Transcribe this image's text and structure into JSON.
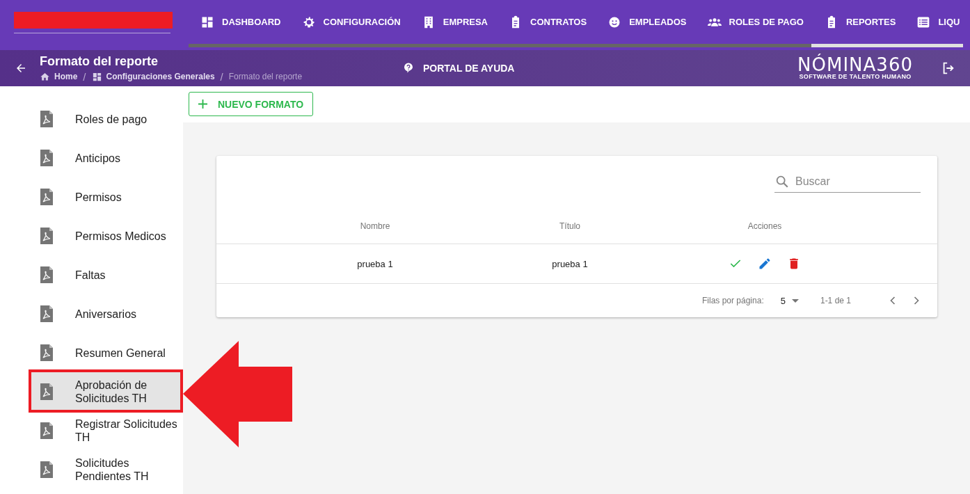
{
  "nav": {
    "items": [
      {
        "label": "DASHBOARD"
      },
      {
        "label": "CONFIGURACIÓN"
      },
      {
        "label": "EMPRESA"
      },
      {
        "label": "CONTRATOS"
      },
      {
        "label": "EMPLEADOS"
      },
      {
        "label": "ROLES DE PAGO"
      },
      {
        "label": "REPORTES"
      },
      {
        "label": "LIQU"
      }
    ]
  },
  "header": {
    "title": "Formato del reporte",
    "breadcrumb": [
      {
        "label": "Home"
      },
      {
        "label": "Configuraciones Generales"
      },
      {
        "label": "Formato del reporte"
      }
    ],
    "separator": "/",
    "help": "PORTAL DE AYUDA",
    "logo": {
      "name": "NÓMINA360",
      "tagline": "SOFTWARE DE TALENTO HUMANO"
    }
  },
  "sidebar": {
    "items": [
      {
        "label": "Roles de pago",
        "selected": false
      },
      {
        "label": "Anticipos",
        "selected": false
      },
      {
        "label": "Permisos",
        "selected": false
      },
      {
        "label": "Permisos Medicos",
        "selected": false
      },
      {
        "label": "Faltas",
        "selected": false
      },
      {
        "label": "Aniversarios",
        "selected": false
      },
      {
        "label": "Resumen General",
        "selected": false
      },
      {
        "label": "Aprobación de Solicitudes TH",
        "selected": true
      },
      {
        "label": "Registrar Solicitudes TH",
        "selected": false
      },
      {
        "label": "Solicitudes Pendientes TH",
        "selected": false
      }
    ]
  },
  "toolbar": {
    "button": "NUEVO FORMATO"
  },
  "table": {
    "search": {
      "placeholder": "Buscar"
    },
    "columns": [
      "Nombre",
      "Título",
      "Acciones"
    ],
    "rows": [
      {
        "cells": [
          "prueba 1",
          "prueba 1"
        ]
      }
    ],
    "pagination": {
      "rows_label": "Filas por página:",
      "rows_value": "5",
      "range": "1-1 de 1"
    }
  }
}
